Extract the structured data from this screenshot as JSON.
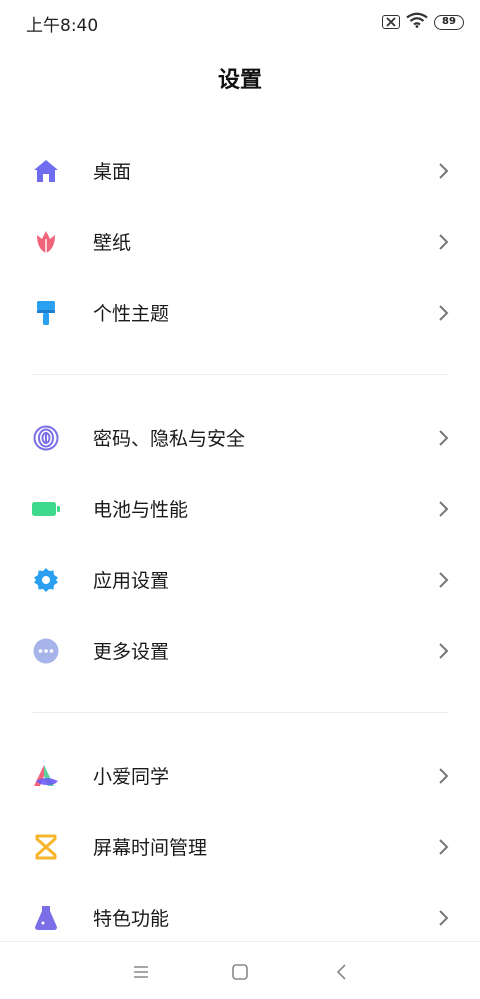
{
  "status_bar": {
    "time": "上午8:40",
    "battery": "89"
  },
  "header": {
    "title": "设置"
  },
  "groups": [
    {
      "items": [
        {
          "label": "桌面",
          "icon": "home-icon",
          "color": "#6f6cf0"
        },
        {
          "label": "壁纸",
          "icon": "tulip-icon",
          "color": "#f0657a"
        },
        {
          "label": "个性主题",
          "icon": "paintbrush-icon",
          "color": "#2b9ff0"
        }
      ]
    },
    {
      "items": [
        {
          "label": "密码、隐私与安全",
          "icon": "fingerprint-icon",
          "color": "#7a6fe6"
        },
        {
          "label": "电池与性能",
          "icon": "battery-icon",
          "color": "#3ed98a"
        },
        {
          "label": "应用设置",
          "icon": "gear-icon",
          "color": "#2b9ff0"
        },
        {
          "label": "更多设置",
          "icon": "more-dots-icon",
          "color": "#a7b4ea"
        }
      ]
    },
    {
      "items": [
        {
          "label": "小爱同学",
          "icon": "xiaoai-icon",
          "color": "#6b5cf5"
        },
        {
          "label": "屏幕时间管理",
          "icon": "hourglass-icon",
          "color": "#f6b52a"
        },
        {
          "label": "特色功能",
          "icon": "flask-icon",
          "color": "#7a6fe6"
        }
      ]
    }
  ],
  "navigation": {
    "menu_icon": "menu-icon",
    "home_icon": "home-square-icon",
    "back_icon": "back-icon"
  }
}
